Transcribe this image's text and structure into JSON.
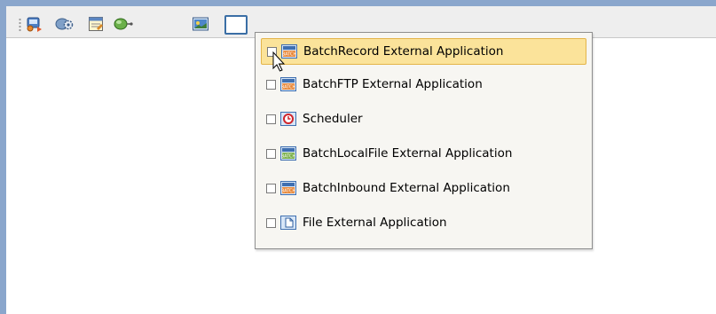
{
  "toolbar": {
    "buttons": [
      {
        "icon": "component-icon"
      },
      {
        "icon": "gear-service-icon"
      },
      {
        "icon": "table-icon"
      },
      {
        "icon": "connector-icon"
      },
      {
        "icon": "image-icon"
      },
      {
        "icon": "window-icon",
        "pressed": true
      }
    ]
  },
  "menu": {
    "items": [
      {
        "label": "BatchRecord External Application",
        "icon": "batch-icon",
        "checked": false,
        "highlighted": true
      },
      {
        "label": "BatchFTP External Application",
        "icon": "batch-icon",
        "checked": false
      },
      {
        "label": "Scheduler",
        "icon": "scheduler-icon",
        "checked": false
      },
      {
        "label": "BatchLocalFile External Application",
        "icon": "batch-icon",
        "checked": false
      },
      {
        "label": "BatchInbound External Application",
        "icon": "batch-icon",
        "checked": false
      },
      {
        "label": "File External Application",
        "icon": "file-icon",
        "checked": false
      }
    ]
  },
  "colors": {
    "frame": "#8aa6cc",
    "highlight": "#fbe39a",
    "highlight_border": "#e3b449",
    "menu_bg": "#f7f6f2"
  }
}
